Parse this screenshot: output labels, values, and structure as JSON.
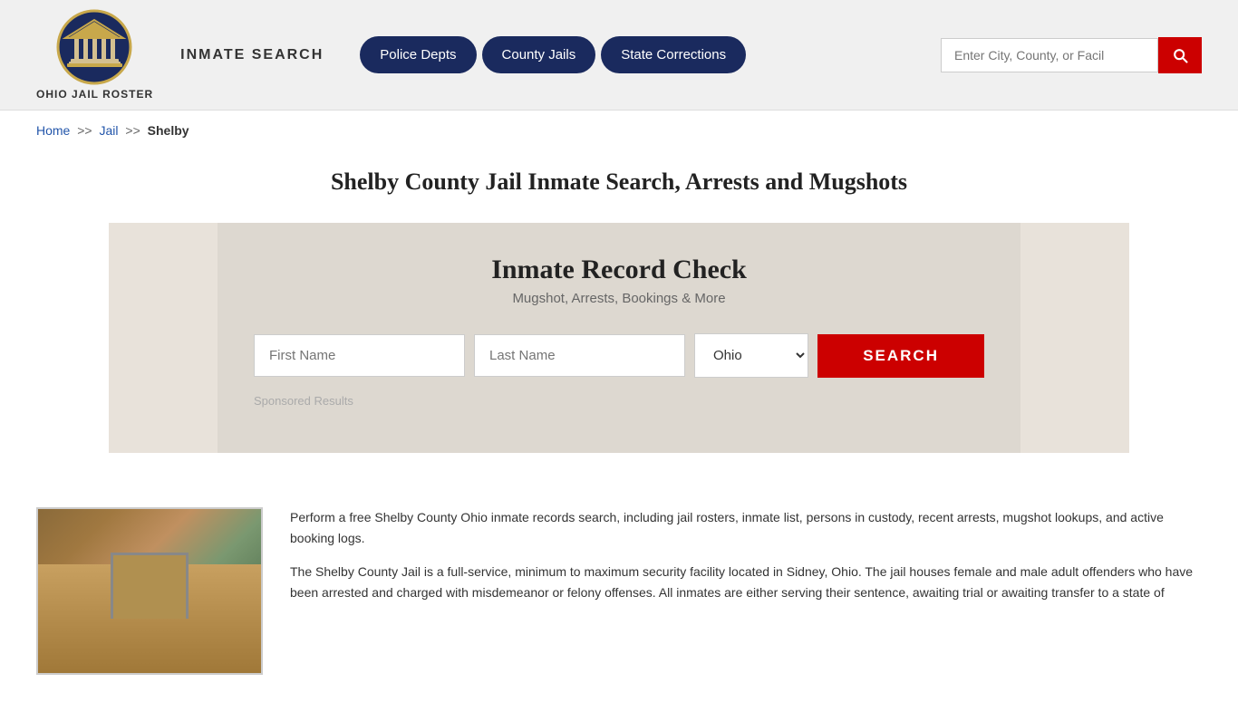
{
  "header": {
    "logo_text": "Ohio Jail Roster",
    "title": "INMATE SEARCH",
    "nav": [
      {
        "label": "Police Depts",
        "id": "police-depts"
      },
      {
        "label": "County Jails",
        "id": "county-jails"
      },
      {
        "label": "State Corrections",
        "id": "state-corrections"
      }
    ],
    "search_placeholder": "Enter City, County, or Facil"
  },
  "breadcrumb": {
    "home": "Home",
    "sep1": ">>",
    "jail": "Jail",
    "sep2": ">>",
    "current": "Shelby"
  },
  "page": {
    "title": "Shelby County Jail Inmate Search, Arrests and Mugshots"
  },
  "record_check": {
    "title": "Inmate Record Check",
    "subtitle": "Mugshot, Arrests, Bookings & More",
    "first_name_placeholder": "First Name",
    "last_name_placeholder": "Last Name",
    "state_value": "Ohio",
    "search_button": "SEARCH",
    "sponsored": "Sponsored Results"
  },
  "content": {
    "para1": "Perform a free Shelby County Ohio inmate records search, including jail rosters, inmate list, persons in custody, recent arrests, mugshot lookups, and active booking logs.",
    "para2": "The Shelby County Jail is a full-service, minimum to maximum security facility located in Sidney, Ohio. The jail houses female and male adult offenders who have been arrested and charged with misdemeanor or felony offenses. All inmates are either serving their sentence, awaiting trial or awaiting transfer to a state of"
  },
  "icons": {
    "search": "&#128269;"
  }
}
